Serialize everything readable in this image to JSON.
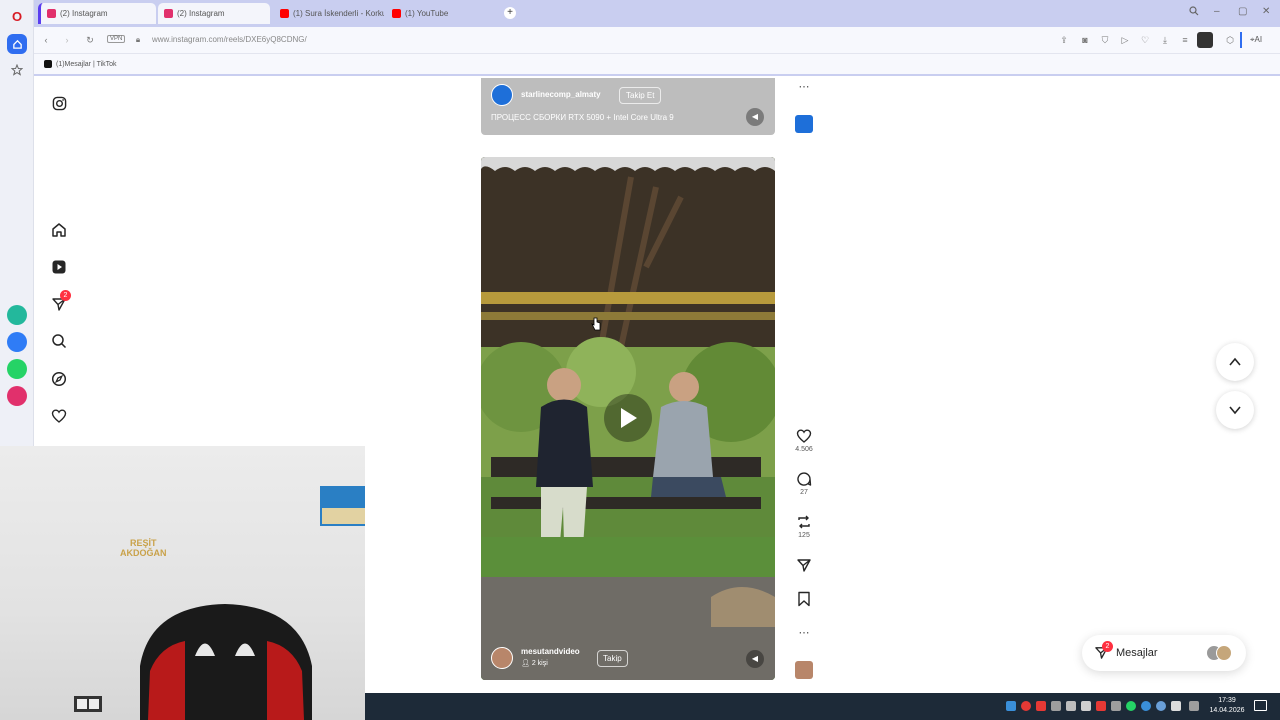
{
  "browser": {
    "tabs": [
      {
        "label": "(2) Instagram",
        "active": true
      },
      {
        "label": "(2) Instagram",
        "active": true
      },
      {
        "label": "(1) Sura İskenderli - Korku",
        "active": false
      },
      {
        "label": "(1) YouTube",
        "active": false
      }
    ],
    "new_tab_label": "+",
    "url": "www.instagram.com/reels/DXE6yQ8CDNG/",
    "vpn_label": "VPN",
    "ai_label": "AI",
    "bookmark": "(1)Mesajlar | TikTok"
  },
  "notifications": {
    "badge_count": "2"
  },
  "reels": {
    "top": {
      "username": "starlinecomp_almaty",
      "follow_label": "Takip Et",
      "caption": "ПРОЦЕСС СБОРКИ RTX 5090 + Intel Core Ultra 9"
    },
    "current": {
      "username": "mesutandvideo",
      "people_label": "2 kişi",
      "follow_label": "Takip",
      "likes": "4.506",
      "comments": "27",
      "reposts": "125"
    }
  },
  "messages": {
    "label": "Mesajlar",
    "badge": "2"
  },
  "webcam_sign": {
    "line1": "REŞİT",
    "line2": "AKDOĞAN"
  },
  "taskbar": {
    "time": "17:39",
    "date": "14.04.2026"
  },
  "colors": {
    "accent": "#ff3040",
    "opera_red": "#d81b24",
    "ig_blue": "#1877f2"
  }
}
